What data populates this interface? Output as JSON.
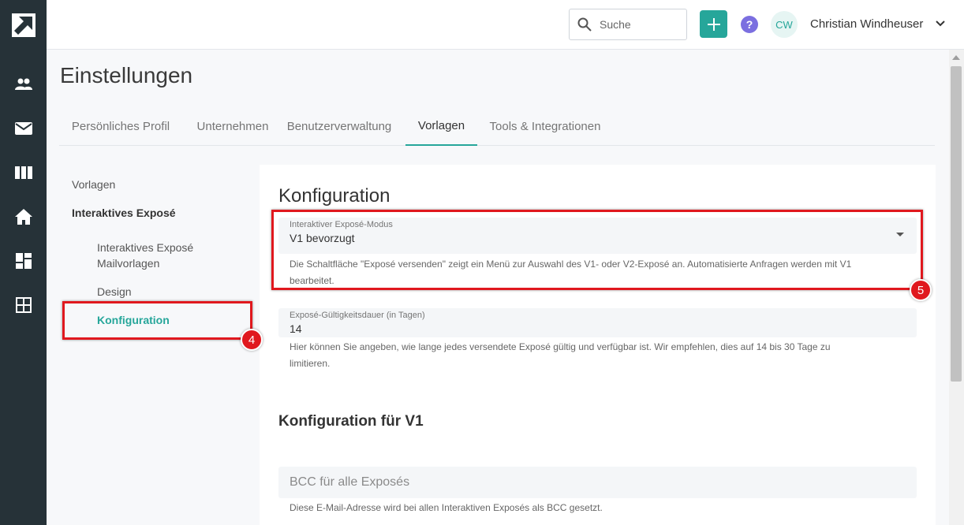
{
  "topbar": {
    "search_placeholder": "Suche",
    "help_glyph": "?",
    "avatar_initials": "CW",
    "username": "Christian Windheuser"
  },
  "page": {
    "title": "Einstellungen"
  },
  "tabs": [
    {
      "label": "Persönliches Profil",
      "active": false
    },
    {
      "label": "Unternehmen",
      "active": false
    },
    {
      "label": "Benutzerverwaltung",
      "active": false
    },
    {
      "label": "Vorlagen",
      "active": true
    },
    {
      "label": "Tools & Integrationen",
      "active": false
    }
  ],
  "sidenav": {
    "vorlagen": "Vorlagen",
    "interaktives_expose": "Interaktives Exposé",
    "interaktives_expose_mailvorlagen_line1": "Interaktives Exposé",
    "interaktives_expose_mailvorlagen_line2": "Mailvorlagen",
    "design": "Design",
    "konfiguration": "Konfiguration"
  },
  "card": {
    "title": "Konfiguration",
    "mode_field": {
      "label": "Interaktiver Exposé-Modus",
      "value": "V1 bevorzugt",
      "help_line1": "Die Schaltfläche \"Exposé versenden\" zeigt ein Menü zur Auswahl des V1- oder V2-Exposé an. Automatisierte Anfragen werden mit V1",
      "help_line2": "bearbeitet."
    },
    "validity_field": {
      "label": "Exposé-Gültigkeitsdauer (in Tagen)",
      "value": "14",
      "help_line1": "Hier können Sie angeben, wie lange jedes versendete Exposé gültig und verfügbar ist. Wir empfehlen, dies auf 14 bis 30 Tage zu",
      "help_line2": "limitieren."
    },
    "v1_section_title": "Konfiguration für V1",
    "bcc_field": {
      "placeholder": "BCC für alle Exposés",
      "help": "Diese E-Mail-Adresse wird bei allen Interaktiven Exposés als BCC gesetzt."
    }
  },
  "annotations": {
    "marker_4": "4",
    "marker_5": "5"
  },
  "colors": {
    "accent": "#26a69a",
    "rail": "#263238",
    "highlight": "#e0181e",
    "help": "#7b6fe0"
  },
  "icons": {
    "rail": [
      "logo-arrow-icon",
      "contacts-icon",
      "mail-icon",
      "columns-icon",
      "home-icon",
      "dashboard-icon",
      "grid-icon"
    ]
  }
}
